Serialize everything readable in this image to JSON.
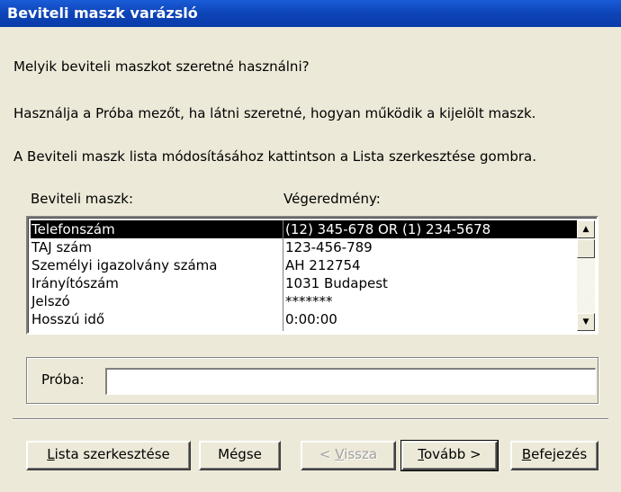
{
  "window": {
    "title": "Beviteli maszk varázsló"
  },
  "instructions": {
    "line1": "Melyik beviteli maszkot szeretné használni?",
    "line2": "Használja a Próba mezőt, ha látni szeretné, hogyan működik a kijelölt maszk.",
    "line3": "A Beviteli maszk lista módosításához kattintson a Lista szerkesztése gombra."
  },
  "list": {
    "col1_header": "Beviteli maszk:",
    "col2_header": "Végeredmény:",
    "rows": [
      {
        "mask": "Telefonszám",
        "result": "(12) 345-678 OR (1) 234-5678",
        "selected": true
      },
      {
        "mask": "TAJ szám",
        "result": "123-456-789"
      },
      {
        "mask": "Személyi igazolvány száma",
        "result": "AH 212754"
      },
      {
        "mask": "Irányítószám",
        "result": "1031 Budapest"
      },
      {
        "mask": "Jelszó",
        "result": "*******"
      },
      {
        "mask": "Hosszú idő",
        "result": "0:00:00"
      }
    ],
    "scroll_up_icon": "▲",
    "scroll_down_icon": "▼"
  },
  "test": {
    "label": "Próba:",
    "value": ""
  },
  "buttons": {
    "edit_list": {
      "mnemonic": "L",
      "rest": "ista szerkesztése"
    },
    "cancel": {
      "label": "Mégse"
    },
    "back": {
      "prefix": "< ",
      "mnemonic": "V",
      "rest": "issza"
    },
    "next": {
      "mnemonic": "T",
      "rest": "ovább >"
    },
    "finish": {
      "mnemonic": "B",
      "rest": "efejezés"
    }
  },
  "colors": {
    "title_bar": "#0a3ca8",
    "selection": "#000000",
    "dialog_bg": "#ece9d8"
  }
}
